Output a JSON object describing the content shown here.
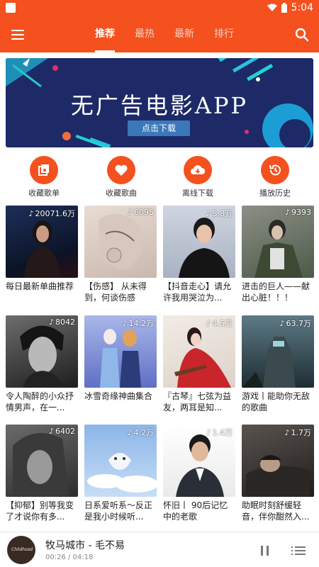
{
  "status_bar": {
    "time": "5:04"
  },
  "tabs": [
    {
      "label": "推荐",
      "active": true
    },
    {
      "label": "最热",
      "active": false
    },
    {
      "label": "最新",
      "active": false
    },
    {
      "label": "排行",
      "active": false
    }
  ],
  "banner": {
    "title": "无广告电影APP",
    "button": "点击下载"
  },
  "quick_actions": [
    {
      "label": "收藏歌单",
      "icon": "playlist-icon"
    },
    {
      "label": "收藏歌曲",
      "icon": "heart-icon"
    },
    {
      "label": "离线下载",
      "icon": "download-cloud-icon"
    },
    {
      "label": "播放历史",
      "icon": "history-icon"
    }
  ],
  "playlists": [
    {
      "count": "20071.6万",
      "title": "每日最新单曲推荐"
    },
    {
      "count": "6095",
      "title": "【伤感】 从未得到，何谈伤感"
    },
    {
      "count": "5.8万",
      "title": "【抖音走心】请允许我用哭泣为..."
    },
    {
      "count": "9393",
      "title": "进击的巨人——献出心脏！！！"
    },
    {
      "count": "8042",
      "title": "令人陶醉的小众抒情男声，在一..."
    },
    {
      "count": "14.2万",
      "title": "冰雪奇缘神曲集合"
    },
    {
      "count": "4.5万",
      "title": "『古琴』七弦为益友，两耳是知..."
    },
    {
      "count": "63.7万",
      "title": "游戏丨能助你无敌的歌曲"
    },
    {
      "count": "6402",
      "title": "【抑郁】别等我变了才说你有多..."
    },
    {
      "count": "4.2万",
      "title": "日系爱听系～反正是我小时候听..."
    },
    {
      "count": "1.4万",
      "title": "怀旧丨 90后记忆中的老歌"
    },
    {
      "count": "1.7万",
      "title": "助眠时刻舒缓轻音，伴你酣然入..."
    }
  ],
  "player": {
    "song": "牧马城市 - 毛不易",
    "time": "00:26 / 04:18",
    "disc_text": "Childhood"
  },
  "colors": {
    "accent": "#f4511e",
    "banner_bg": "#1d2a67"
  }
}
